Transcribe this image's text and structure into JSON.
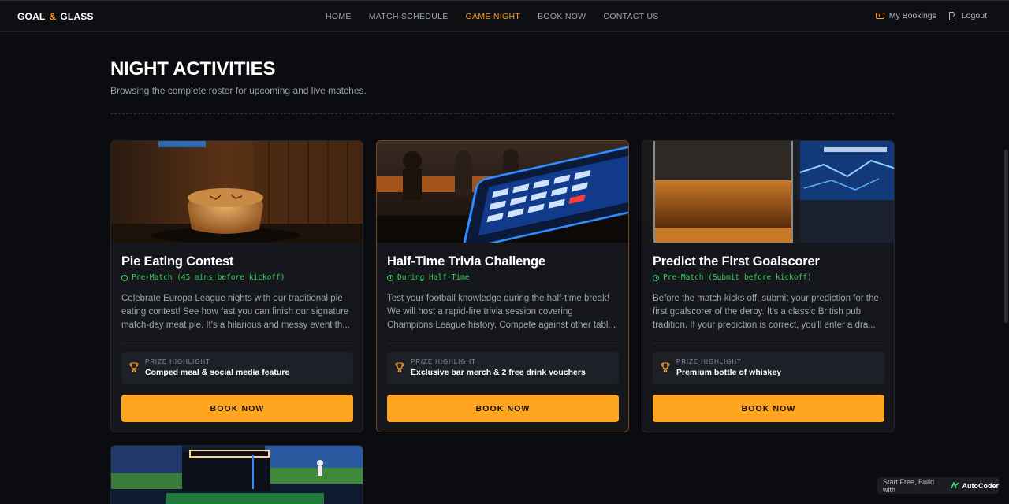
{
  "nav": {
    "logo_left": "GOAL",
    "logo_amp": "&",
    "logo_right": "GLASS",
    "items": [
      "HOME",
      "MATCH SCHEDULE",
      "GAME NIGHT",
      "BOOK NOW",
      "CONTACT US"
    ],
    "active": "GAME NIGHT",
    "my_bookings": "My Bookings",
    "logout": "Logout"
  },
  "header": {
    "title": "NIGHT ACTIVITIES",
    "subtitle": "Browsing the complete roster for upcoming and live matches."
  },
  "cards": [
    {
      "title": "Pie Eating Contest",
      "timing": "Pre-Match (45 mins before kickoff)",
      "desc": "Celebrate Europa League nights with our traditional pie eating contest! See how fast you can finish our signature match-day meat pie. It's a hilarious and messy event th...",
      "prize_label": "PRIZE HIGHLIGHT",
      "prize": "Comped meal & social media feature",
      "button": "BOOK NOW"
    },
    {
      "title": "Half-Time Trivia Challenge",
      "timing": "During Half-Time",
      "desc": "Test your football knowledge during the half-time break! We will host a rapid-fire trivia session covering Champions League history. Compete against other tabl...",
      "prize_label": "PRIZE HIGHLIGHT",
      "prize": "Exclusive bar merch & 2 free drink vouchers",
      "button": "BOOK NOW"
    },
    {
      "title": "Predict the First Goalscorer",
      "timing": "Pre-Match (Submit before kickoff)",
      "desc": "Before the match kicks off, submit your prediction for the first goalscorer of the derby. It's a classic British pub tradition. If your prediction is correct, you'll enter a dra...",
      "prize_label": "PRIZE HIGHLIGHT",
      "prize": "Premium bottle of whiskey",
      "button": "BOOK NOW"
    }
  ],
  "badge": {
    "text": "Start Free, Build with",
    "brand": "AutoCoder"
  },
  "colors": {
    "accent": "#ffa41f",
    "timing_green": "#34d158",
    "background": "#0b0c10",
    "card": "#15171d"
  }
}
